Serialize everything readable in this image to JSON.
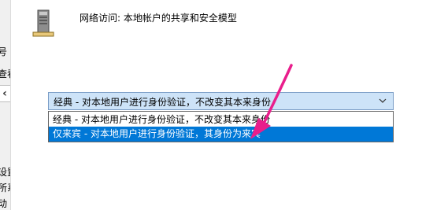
{
  "left_strip": {
    "fragments": [
      "号",
      "查看",
      "设置",
      "所系",
      "动"
    ]
  },
  "policy": {
    "title": "网络访问: 本地帐户的共享和安全模型",
    "icon": "server-policy-icon"
  },
  "combo": {
    "selected_value": "经典 - 对本地用户进行身份验证，不改变其本来身份",
    "arrow_icon": "chevron-down-icon"
  },
  "dropdown": {
    "options": [
      "经典 - 对本地用户进行身份验证，不改变其本来身份",
      "仅来宾 - 对本地用户进行身份验证，其身份为来宾"
    ],
    "highlighted_index": 1,
    "highlight_color": "#0078d7"
  },
  "annotation": {
    "arrow_color": "#e91e8c"
  }
}
